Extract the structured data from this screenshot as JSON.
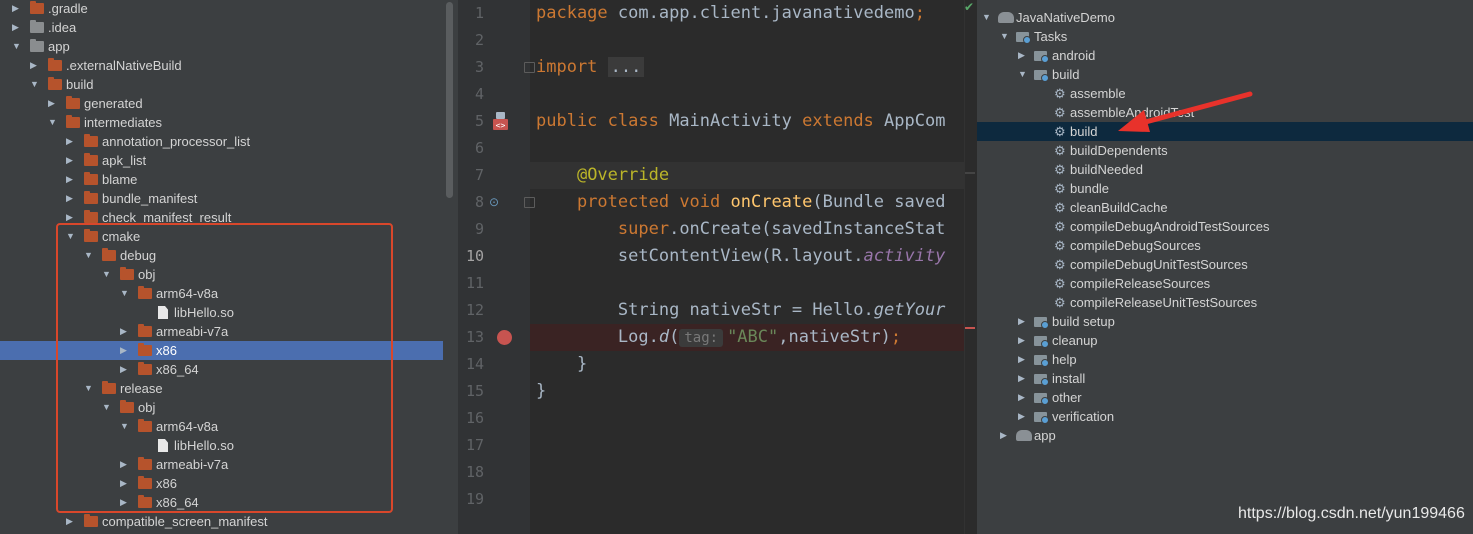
{
  "project_tree": {
    "rows": [
      {
        "label": ".gradle",
        "depth": 1,
        "arrow": "right",
        "icon": "folder",
        "color": "orange"
      },
      {
        "label": ".idea",
        "depth": 1,
        "arrow": "right",
        "icon": "folder",
        "color": "grey"
      },
      {
        "label": "app",
        "depth": 1,
        "arrow": "down",
        "icon": "folder",
        "color": "grey"
      },
      {
        "label": ".externalNativeBuild",
        "depth": 2,
        "arrow": "right",
        "icon": "folder",
        "color": "orange"
      },
      {
        "label": "build",
        "depth": 2,
        "arrow": "down",
        "icon": "folder",
        "color": "orange"
      },
      {
        "label": "generated",
        "depth": 3,
        "arrow": "right",
        "icon": "folder",
        "color": "orange"
      },
      {
        "label": "intermediates",
        "depth": 3,
        "arrow": "down",
        "icon": "folder",
        "color": "orange"
      },
      {
        "label": "annotation_processor_list",
        "depth": 4,
        "arrow": "right",
        "icon": "folder",
        "color": "orange"
      },
      {
        "label": "apk_list",
        "depth": 4,
        "arrow": "right",
        "icon": "folder",
        "color": "orange"
      },
      {
        "label": "blame",
        "depth": 4,
        "arrow": "right",
        "icon": "folder",
        "color": "orange"
      },
      {
        "label": "bundle_manifest",
        "depth": 4,
        "arrow": "right",
        "icon": "folder",
        "color": "orange"
      },
      {
        "label": "check_manifest_result",
        "depth": 4,
        "arrow": "right",
        "icon": "folder",
        "color": "orange"
      },
      {
        "label": "cmake",
        "depth": 4,
        "arrow": "down",
        "icon": "folder",
        "color": "orange"
      },
      {
        "label": "debug",
        "depth": 5,
        "arrow": "down",
        "icon": "folder",
        "color": "orange"
      },
      {
        "label": "obj",
        "depth": 6,
        "arrow": "down",
        "icon": "folder",
        "color": "orange"
      },
      {
        "label": "arm64-v8a",
        "depth": 7,
        "arrow": "down",
        "icon": "folder",
        "color": "orange"
      },
      {
        "label": "libHello.so",
        "depth": 8,
        "arrow": "",
        "icon": "file",
        "color": "white"
      },
      {
        "label": "armeabi-v7a",
        "depth": 7,
        "arrow": "right",
        "icon": "folder",
        "color": "orange"
      },
      {
        "label": "x86",
        "depth": 7,
        "arrow": "right",
        "icon": "folder",
        "color": "orange",
        "selected": true
      },
      {
        "label": "x86_64",
        "depth": 7,
        "arrow": "right",
        "icon": "folder",
        "color": "orange"
      },
      {
        "label": "release",
        "depth": 5,
        "arrow": "down",
        "icon": "folder",
        "color": "orange"
      },
      {
        "label": "obj",
        "depth": 6,
        "arrow": "down",
        "icon": "folder",
        "color": "orange"
      },
      {
        "label": "arm64-v8a",
        "depth": 7,
        "arrow": "down",
        "icon": "folder",
        "color": "orange"
      },
      {
        "label": "libHello.so",
        "depth": 8,
        "arrow": "",
        "icon": "file",
        "color": "white"
      },
      {
        "label": "armeabi-v7a",
        "depth": 7,
        "arrow": "right",
        "icon": "folder",
        "color": "orange"
      },
      {
        "label": "x86",
        "depth": 7,
        "arrow": "right",
        "icon": "folder",
        "color": "orange"
      },
      {
        "label": "x86_64",
        "depth": 7,
        "arrow": "right",
        "icon": "folder",
        "color": "orange"
      },
      {
        "label": "compatible_screen_manifest",
        "depth": 4,
        "arrow": "right",
        "icon": "folder",
        "color": "orange"
      }
    ]
  },
  "editor": {
    "line_numbers": [
      "1",
      "2",
      "3",
      "4",
      "5",
      "6",
      "7",
      "8",
      "9",
      "10",
      "11",
      "12",
      "13",
      "14",
      "15",
      "16",
      "17",
      "18",
      "19"
    ],
    "current_line": "10",
    "lines": [
      [
        {
          "t": "package ",
          "c": "kw"
        },
        {
          "t": "com.app.client.javanativedemo",
          "c": ""
        },
        {
          "t": ";",
          "c": "kw"
        }
      ],
      [],
      [
        {
          "t": "import ",
          "c": "kw"
        },
        {
          "t": "...",
          "c": "fold"
        }
      ],
      [],
      [
        {
          "t": "public ",
          "c": "kw"
        },
        {
          "t": "class ",
          "c": "kw"
        },
        {
          "t": "MainActivity ",
          "c": ""
        },
        {
          "t": "extends ",
          "c": "kw"
        },
        {
          "t": "AppCom",
          "c": ""
        }
      ],
      [],
      [
        {
          "t": "    ",
          "c": ""
        },
        {
          "t": "@Override",
          "c": "ann"
        }
      ],
      [
        {
          "t": "    ",
          "c": ""
        },
        {
          "t": "protected ",
          "c": "kw"
        },
        {
          "t": "void ",
          "c": "kw"
        },
        {
          "t": "onCreate",
          "c": "fn"
        },
        {
          "t": "(Bundle saved",
          "c": ""
        }
      ],
      [
        {
          "t": "        ",
          "c": ""
        },
        {
          "t": "super",
          "c": "kw"
        },
        {
          "t": ".onCreate(savedInstanceStat",
          "c": ""
        }
      ],
      [
        {
          "t": "        ",
          "c": ""
        },
        {
          "t": "setContentView(R.layout.",
          "c": ""
        },
        {
          "t": "activity",
          "c": "it"
        }
      ],
      [],
      [
        {
          "t": "        ",
          "c": ""
        },
        {
          "t": "String nativeStr = Hello.",
          "c": ""
        },
        {
          "t": "getYour",
          "c": "itw"
        }
      ],
      [
        {
          "t": "        ",
          "c": ""
        },
        {
          "t": "Log.",
          "c": ""
        },
        {
          "t": "d",
          "c": "itw"
        },
        {
          "t": "(",
          "c": ""
        },
        {
          "t": "tag:",
          "c": "hint"
        },
        {
          "t": "\"ABC\"",
          "c": "str"
        },
        {
          "t": ",nativeStr)",
          "c": ""
        },
        {
          "t": ";",
          "c": "kw"
        }
      ],
      [
        {
          "t": "    }",
          "c": ""
        }
      ],
      [
        {
          "t": "}",
          "c": ""
        }
      ],
      []
    ]
  },
  "gradle": {
    "rows": [
      {
        "label": "JavaNativeDemo",
        "x": 0,
        "arrow": "down",
        "icon": "elephant"
      },
      {
        "label": "Tasks",
        "x": 1,
        "arrow": "down",
        "icon": "taskfolder"
      },
      {
        "label": "android",
        "x": 2,
        "arrow": "right",
        "icon": "taskfolder"
      },
      {
        "label": "build",
        "x": 2,
        "arrow": "down",
        "icon": "taskfolder"
      },
      {
        "label": "assemble",
        "x": 3,
        "arrow": "",
        "icon": "gear"
      },
      {
        "label": "assembleAndroidTest",
        "x": 3,
        "arrow": "",
        "icon": "gear"
      },
      {
        "label": "build",
        "x": 3,
        "arrow": "",
        "icon": "gear",
        "selected": true
      },
      {
        "label": "buildDependents",
        "x": 3,
        "arrow": "",
        "icon": "gear"
      },
      {
        "label": "buildNeeded",
        "x": 3,
        "arrow": "",
        "icon": "gear"
      },
      {
        "label": "bundle",
        "x": 3,
        "arrow": "",
        "icon": "gear"
      },
      {
        "label": "cleanBuildCache",
        "x": 3,
        "arrow": "",
        "icon": "gear"
      },
      {
        "label": "compileDebugAndroidTestSources",
        "x": 3,
        "arrow": "",
        "icon": "gear"
      },
      {
        "label": "compileDebugSources",
        "x": 3,
        "arrow": "",
        "icon": "gear"
      },
      {
        "label": "compileDebugUnitTestSources",
        "x": 3,
        "arrow": "",
        "icon": "gear"
      },
      {
        "label": "compileReleaseSources",
        "x": 3,
        "arrow": "",
        "icon": "gear"
      },
      {
        "label": "compileReleaseUnitTestSources",
        "x": 3,
        "arrow": "",
        "icon": "gear"
      },
      {
        "label": "build setup",
        "x": 2,
        "arrow": "right",
        "icon": "taskfolder"
      },
      {
        "label": "cleanup",
        "x": 2,
        "arrow": "right",
        "icon": "taskfolder"
      },
      {
        "label": "help",
        "x": 2,
        "arrow": "right",
        "icon": "taskfolder"
      },
      {
        "label": "install",
        "x": 2,
        "arrow": "right",
        "icon": "taskfolder"
      },
      {
        "label": "other",
        "x": 2,
        "arrow": "right",
        "icon": "taskfolder"
      },
      {
        "label": "verification",
        "x": 2,
        "arrow": "right",
        "icon": "taskfolder"
      },
      {
        "label": "app",
        "x": 1,
        "arrow": "right",
        "icon": "elephant"
      }
    ]
  },
  "watermark": "https://blog.csdn.net/yun199466",
  "colors": {
    "accent_selection": "#4b6eaf",
    "highlight_box": "#d9472b",
    "arrow": "#e8322b"
  }
}
